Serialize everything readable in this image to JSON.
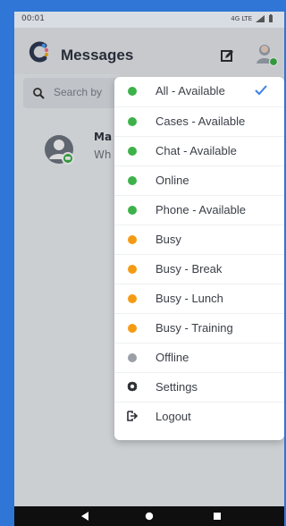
{
  "status": {
    "time": "00:01",
    "network": "4G LTE"
  },
  "appbar": {
    "title": "Messages"
  },
  "search": {
    "placeholder": "Search by"
  },
  "conversation": {
    "name": "Ma",
    "preview": "Wh"
  },
  "menu": {
    "items": [
      {
        "label": "All - Available",
        "status_color": "#3db24a",
        "checked": true
      },
      {
        "label": "Cases - Available",
        "status_color": "#3db24a"
      },
      {
        "label": "Chat - Available",
        "status_color": "#3db24a"
      },
      {
        "label": "Online",
        "status_color": "#3db24a"
      },
      {
        "label": "Phone - Available",
        "status_color": "#3db24a"
      },
      {
        "label": "Busy",
        "status_color": "#f59b13"
      },
      {
        "label": "Busy - Break",
        "status_color": "#f59b13"
      },
      {
        "label": "Busy - Lunch",
        "status_color": "#f59b13"
      },
      {
        "label": "Busy - Training",
        "status_color": "#f59b13"
      },
      {
        "label": "Offline",
        "status_color": "#9aa0a6"
      },
      {
        "label": "Settings",
        "icon": "gear-icon"
      },
      {
        "label": "Logout",
        "icon": "logout-icon"
      }
    ]
  },
  "colors": {
    "outer_frame": "#2f76d6",
    "check": "#3b82e6"
  }
}
